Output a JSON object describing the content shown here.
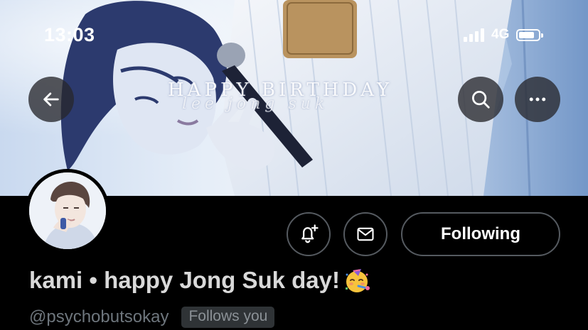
{
  "status_bar": {
    "time": "13:03",
    "network": "4G",
    "signal_bars": 4,
    "battery_level": 0.8
  },
  "header": {
    "back_icon": "arrow-left-icon",
    "search_icon": "search-icon",
    "more_icon": "more-horizontal-icon"
  },
  "banner": {
    "title": "HAPPY BIRTHDAY",
    "subtitle": "lee jong suk"
  },
  "profile": {
    "display_name": "kami • happy Jong Suk day!",
    "display_name_emoji": "partying-face-emoji",
    "handle": "@psychobutsokay",
    "follows_you_label": "Follows you",
    "notify_icon": "bell-plus-icon",
    "message_icon": "envelope-icon",
    "following_label": "Following"
  },
  "colors": {
    "background": "#000000",
    "name_text": "#d9d9d9",
    "secondary_text": "#6e767d",
    "button_border": "#555a60",
    "badge_bg": "#2f3336"
  }
}
